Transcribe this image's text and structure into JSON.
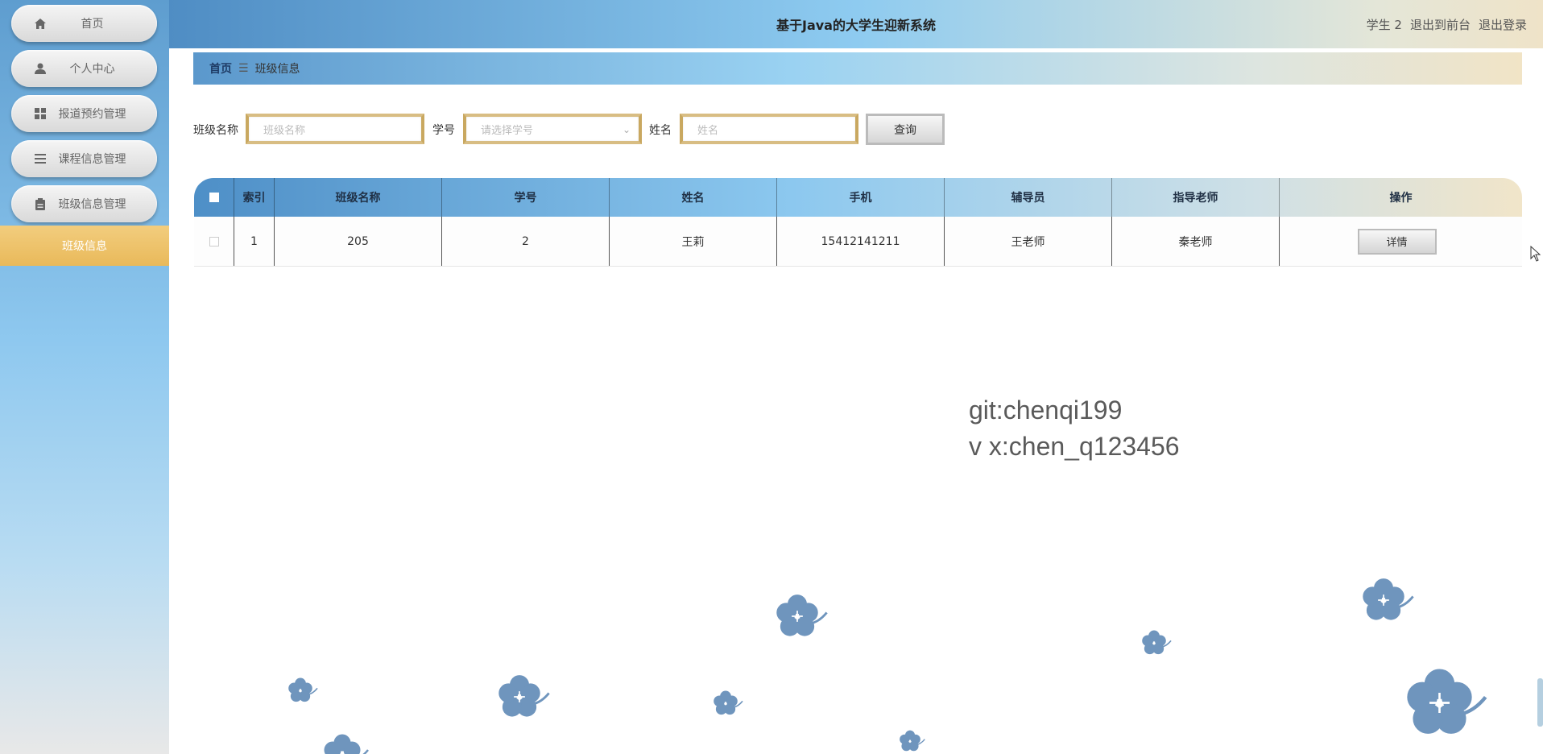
{
  "sidebar": {
    "items": [
      {
        "label": "首页",
        "icon": "home-icon"
      },
      {
        "label": "个人中心",
        "icon": "user-icon"
      },
      {
        "label": "报道预约管理",
        "icon": "grid-icon"
      },
      {
        "label": "课程信息管理",
        "icon": "list-icon"
      },
      {
        "label": "班级信息管理",
        "icon": "clipboard-icon"
      }
    ],
    "active_sub_item": "班级信息"
  },
  "header": {
    "title": "基于Java的大学生迎新系统",
    "user": "学生 2",
    "to_front": "退出到前台",
    "logout": "退出登录"
  },
  "breadcrumb": {
    "home": "首页",
    "separator": "☰",
    "current": "班级信息"
  },
  "search": {
    "class_label": "班级名称",
    "class_placeholder": "班级名称",
    "student_label": "学号",
    "student_placeholder": "请选择学号",
    "name_label": "姓名",
    "name_placeholder": "姓名",
    "query_button": "查询"
  },
  "table": {
    "headers": [
      "",
      "索引",
      "班级名称",
      "学号",
      "姓名",
      "手机",
      "辅导员",
      "指导老师",
      "操作"
    ],
    "rows": [
      {
        "index": "1",
        "class_name": "205",
        "student_no": "2",
        "name": "王莉",
        "phone": "15412141211",
        "counselor": "王老师",
        "advisor": "秦老师",
        "action": "详情"
      }
    ]
  },
  "watermark": {
    "line1": "git:chenqi199",
    "line2": "v x:chen_q123456"
  },
  "colors": {
    "accent_blue": "#5e9dcf",
    "accent_gold": "#e9b95a",
    "clover": "#6f95bd"
  }
}
